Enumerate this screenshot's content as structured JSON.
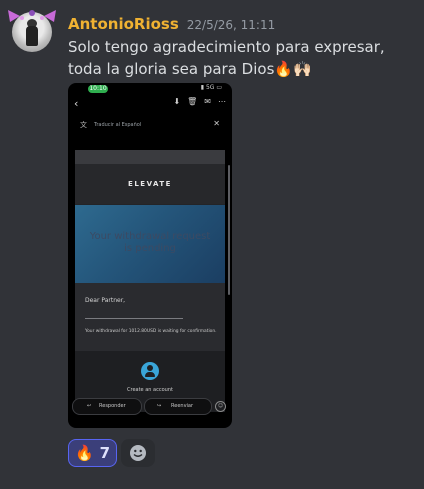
{
  "message": {
    "username": "AntonioRioss",
    "timestamp": "22/5/26, 11:11",
    "text": "Solo tengo agradecimiento para expresar, toda la gloria sea para Dios",
    "text_emojis": "🔥🙌🏻",
    "username_color": "#f0b232"
  },
  "attachment": {
    "status_time": "10:10",
    "status_right": "5G",
    "translate_label": "Traducir al Español",
    "email": {
      "logo": "ELEVATE",
      "banner_text": "Your withdrawal request is pending",
      "greeting": "Dear Partner,",
      "withdraw_text": "Your withdrawal for 1012.80USD is waiting for confirmation.",
      "create_account": "Create an account"
    },
    "actions": {
      "reply": "Responder",
      "forward": "Reenviar"
    }
  },
  "reactions": [
    {
      "emoji": "🔥",
      "count": "7",
      "selected": true
    }
  ],
  "icons": {
    "add_reaction": "smiley-add-icon"
  },
  "colors": {
    "background": "#313338",
    "reaction_bg": "#3b3f7a",
    "reaction_border": "#5865f2"
  }
}
